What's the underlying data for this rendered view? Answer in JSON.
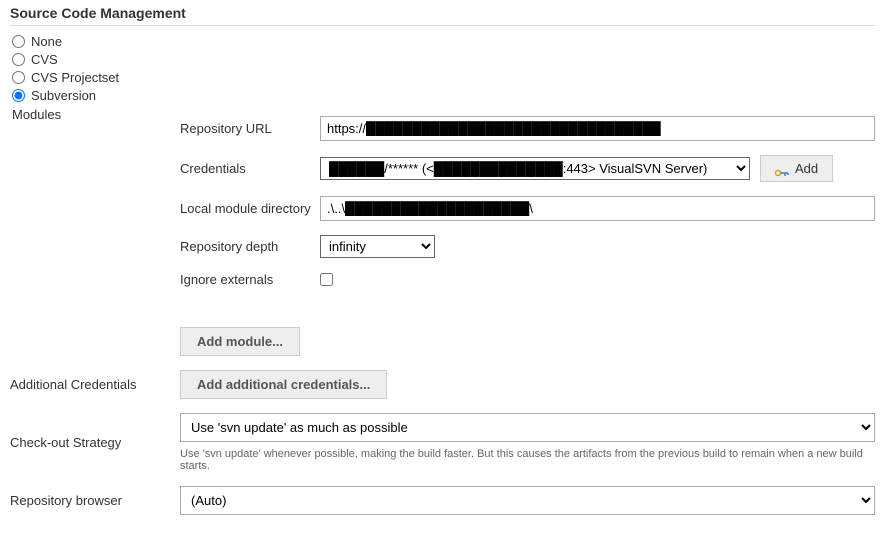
{
  "section_title": "Source Code Management",
  "scm_options": {
    "none": "None",
    "cvs": "CVS",
    "cvs_projectset": "CVS Projectset",
    "subversion": "Subversion"
  },
  "modules_label": "Modules",
  "fields": {
    "repository_url": {
      "label": "Repository URL",
      "value": "https://████████████████████████████████"
    },
    "credentials": {
      "label": "Credentials",
      "selected": "██████/****** (<██████████████:443> VisualSVN Server)",
      "add_button": "Add"
    },
    "local_module_dir": {
      "label": "Local module directory",
      "value": ".\\..\\████████████████████\\"
    },
    "repository_depth": {
      "label": "Repository depth",
      "selected": "infinity"
    },
    "ignore_externals": {
      "label": "Ignore externals"
    }
  },
  "buttons": {
    "add_module": "Add module...",
    "add_credentials": "Add additional credentials..."
  },
  "additional_credentials_label": "Additional Credentials",
  "checkout_strategy": {
    "label": "Check-out Strategy",
    "selected": "Use 'svn update' as much as possible",
    "help": "Use 'svn update' whenever possible, making the build faster. But this causes the artifacts from the previous build to remain when a new build starts."
  },
  "repository_browser": {
    "label": "Repository browser",
    "selected": "(Auto)"
  }
}
